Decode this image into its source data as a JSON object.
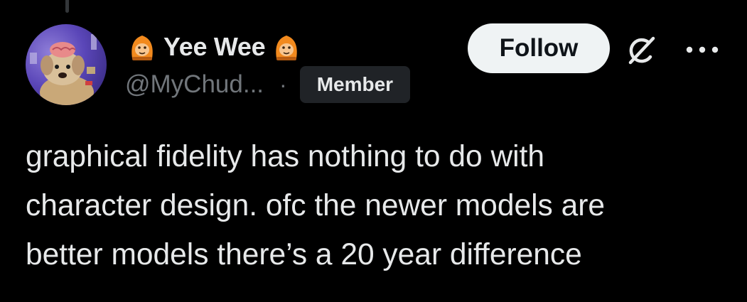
{
  "post": {
    "display_name": "Yee Wee",
    "handle": "@MyChud...",
    "separator": "·",
    "badge": "Member",
    "follow_label": "Follow",
    "text": "graphical fidelity has nothing to do with\ncharacter design. ofc the newer models are\nbetter models there’s a 20 year difference"
  },
  "icons": {
    "avatar": "dog-with-brain-avatar",
    "name_emoji": "orange-monkey-emoji",
    "grok": "grok-icon",
    "more": "more-dots-icon"
  },
  "colors": {
    "background": "#000000",
    "text_primary": "#e7e9ea",
    "text_secondary": "#71767b",
    "follow_bg": "#eff3f4",
    "badge_bg": "#202327",
    "emoji_orange": "#f28a1e"
  }
}
